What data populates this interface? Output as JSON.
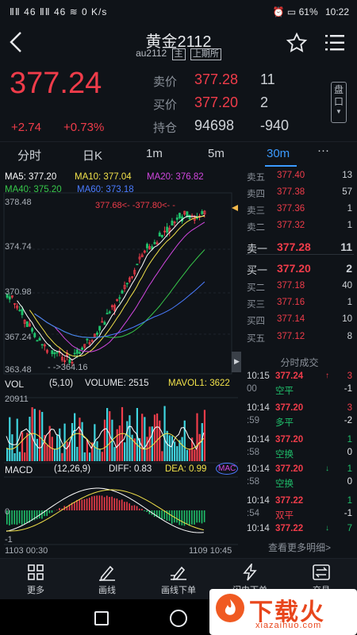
{
  "status_bar": {
    "left": "ⅡⅡ 46 ⅡⅡ 46 ≋ 0 K/s",
    "battery": "61%",
    "time": "10:22"
  },
  "header": {
    "title": "黄金2112",
    "code": "au2112",
    "tag1": "主",
    "tag2": "上期所"
  },
  "quote": {
    "price": "377.24",
    "change": "+2.74",
    "change_pct": "+0.73%",
    "ask_label": "卖价",
    "ask_price": "377.28",
    "ask_qty": "11",
    "bid_label": "买价",
    "bid_price": "377.20",
    "bid_qty": "2",
    "oi_label": "持仓",
    "oi_value": "94698",
    "oi_change": "-940",
    "pankou": "盘口"
  },
  "tabs": [
    "分时",
    "日K",
    "1m",
    "5m",
    "30m",
    "···"
  ],
  "chart_legend": {
    "ma5": "MA5: 377.20",
    "ma10": "MA10: 377.04",
    "ma20": "MA20: 376.82",
    "ma40": "MA40: 375.20",
    "ma60": "MA60: 373.18"
  },
  "axis": {
    "y1": "378.48",
    "y2": "374.74",
    "y3": "370.98",
    "y4": "367.24",
    "y5": "363.48"
  },
  "annotations": {
    "high": "377.68<- -377.80<- -",
    "low": "- ->364.16"
  },
  "volume": {
    "label": "VOL",
    "params": "(5,10)",
    "volume": "VOLUME: 2515",
    "mavol": "MAVOL1: 3622",
    "max": "20911"
  },
  "macd": {
    "label": "MACD",
    "params": "(12,26,9)",
    "diff": "DIFF: 0.83",
    "dea": "DEA: 0.99",
    "extra": "MAC",
    "zero": "0",
    "neg": "-1"
  },
  "time_axis": {
    "start": "1103 00:30",
    "end": "1109 10:45"
  },
  "colors": {
    "up": "#f03c4a",
    "down": "#1fc16b",
    "ma5": "#ffffff",
    "ma10": "#f2e24a",
    "ma20": "#d247e0",
    "ma40": "#37c84a",
    "ma60": "#4a7bff",
    "accent": "#3b9bff"
  },
  "order_book": {
    "asks": [
      {
        "name": "卖五",
        "price": "377.40",
        "qty": "13"
      },
      {
        "name": "卖四",
        "price": "377.38",
        "qty": "57"
      },
      {
        "name": "卖三",
        "price": "377.36",
        "qty": "1"
      },
      {
        "name": "卖二",
        "price": "377.32",
        "qty": "1"
      },
      {
        "name": "卖一",
        "price": "377.28",
        "qty": "11"
      }
    ],
    "bids": [
      {
        "name": "买一",
        "price": "377.20",
        "qty": "2"
      },
      {
        "name": "买二",
        "price": "377.18",
        "qty": "40"
      },
      {
        "name": "买三",
        "price": "377.16",
        "qty": "1"
      },
      {
        "name": "买四",
        "price": "377.14",
        "qty": "10"
      },
      {
        "name": "买五",
        "price": "377.12",
        "qty": "8"
      }
    ]
  },
  "ticks_title": "分时成交",
  "ticks": [
    {
      "t1": "10:15",
      "t2": "00",
      "price": "377.24",
      "kind": "空平",
      "arrow": "↑",
      "vol": "3",
      "delta": "-1",
      "vcolor": "#f03c4a",
      "kcolor": "#1fc16b"
    },
    {
      "t1": "10:14",
      "t2": ":59",
      "price": "377.20",
      "kind": "多平",
      "arrow": "",
      "vol": "3",
      "delta": "-2",
      "vcolor": "#f03c4a",
      "kcolor": "#1fc16b"
    },
    {
      "t1": "10:14",
      "t2": ":58",
      "price": "377.20",
      "kind": "空换",
      "arrow": "",
      "vol": "1",
      "delta": "0",
      "vcolor": "#1fc16b",
      "kcolor": "#1fc16b"
    },
    {
      "t1": "10:14",
      "t2": ":58",
      "price": "377.20",
      "kind": "空换",
      "arrow": "↓",
      "vol": "1",
      "delta": "0",
      "vcolor": "#1fc16b",
      "kcolor": "#1fc16b"
    },
    {
      "t1": "10:14",
      "t2": ":54",
      "price": "377.22",
      "kind": "双平",
      "arrow": "",
      "vol": "1",
      "delta": "-1",
      "vcolor": "#1fc16b",
      "kcolor": "#f03c4a"
    },
    {
      "t1": "10:14",
      "t2": "",
      "price": "377.22",
      "kind": "",
      "arrow": "↓",
      "vol": "7",
      "delta": "",
      "vcolor": "#1fc16b",
      "kcolor": "#1fc16b"
    }
  ],
  "more_detail": "查看更多明细>",
  "toolbar": [
    "更多",
    "画线",
    "画线下单",
    "闪电下单",
    "交易"
  ],
  "watermark": {
    "big": "下载火",
    "small": "xiazaihuo.com"
  }
}
